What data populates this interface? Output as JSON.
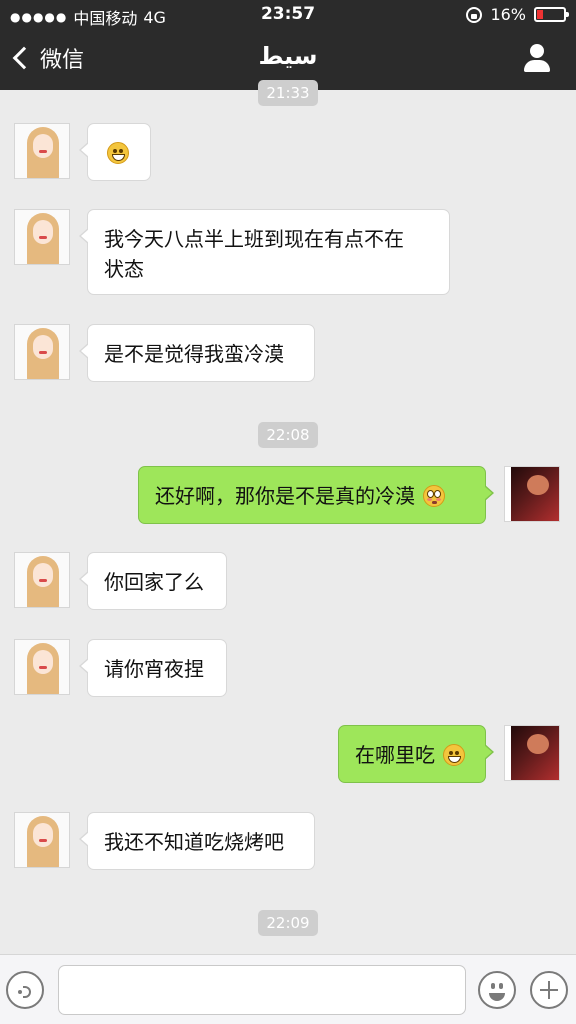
{
  "status": {
    "carrier": "中国移动",
    "network": "4G",
    "time": "23:57",
    "battery": "16%"
  },
  "nav": {
    "back_label": "微信",
    "title": "سيط"
  },
  "timestamps": [
    "21:33",
    "22:08",
    "22:09"
  ],
  "messages": [
    {
      "sender": "other",
      "text": "",
      "emoji": "grin-icon"
    },
    {
      "sender": "other",
      "text_line1": "我今天八点半上班到现在有点不在",
      "text_line2": "状态"
    },
    {
      "sender": "other",
      "text": "是不是觉得我蛮冷漠"
    },
    {
      "sender": "me",
      "text": "还好啊，那你是不是真的冷漠",
      "emoji": "flushed-icon"
    },
    {
      "sender": "other",
      "text": "你回家了么"
    },
    {
      "sender": "other",
      "text": "请你宵夜捏"
    },
    {
      "sender": "me",
      "text": "在哪里吃",
      "emoji": "grin-icon"
    },
    {
      "sender": "other",
      "text": "我还不知道吃烧烤吧"
    }
  ],
  "input": {
    "placeholder": ""
  },
  "colors": {
    "nav_bg": "#2b2b2b",
    "chat_bg": "#ebebeb",
    "outgoing_bubble": "#9ee65a",
    "incoming_bubble": "#ffffff"
  }
}
